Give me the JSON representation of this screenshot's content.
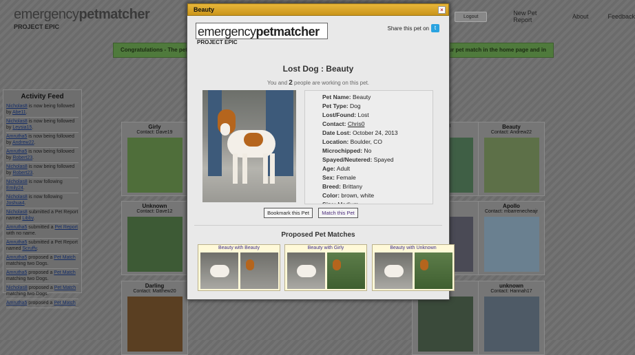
{
  "site": {
    "logo_light": "emergency",
    "logo_bold": "petmatcher",
    "subtitle": "PROJECT EPIC"
  },
  "nav": {
    "logout": "Logout",
    "links": [
      "New Pet Report",
      "About",
      "Feedback"
    ]
  },
  "banner": {
    "left": "Congratulations - The pet",
    "right": "our pet match in the home page and in"
  },
  "activity": {
    "title": "Activity Feed",
    "items": [
      {
        "user": "Nicholas8",
        "text": " is now being followed by ",
        "target": "Abe11",
        "tail": "."
      },
      {
        "user": "Nicholas8",
        "text": " is now being followed by ",
        "target": "Leysia15",
        "tail": "."
      },
      {
        "user": "Amrutha5",
        "text": " is now being followed by ",
        "target": "Andrew22",
        "tail": "."
      },
      {
        "user": "Amrutha5",
        "text": " is now being followed by ",
        "target": "Robert23",
        "tail": "."
      },
      {
        "user": "Nicholas8",
        "text": " is now being followed by ",
        "target": "Robert23",
        "tail": "."
      },
      {
        "user": "Nicholas8",
        "text": " is now following ",
        "target": "Emily24",
        "tail": "."
      },
      {
        "user": "Nicholas8",
        "text": " is now following ",
        "target": "Joshua4",
        "tail": "."
      },
      {
        "user": "Nicholas8",
        "text": " submitted a Pet Report named ",
        "target": "Libby",
        "tail": "."
      },
      {
        "user": "Amrutha5",
        "text": " submitted a ",
        "target": "Pet Report",
        "tail": " with no name."
      },
      {
        "user": "Amrutha5",
        "text": " submitted a Pet Report named ",
        "target": "Scruffy",
        "tail": "."
      },
      {
        "user": "Amrutha5",
        "text": " proposed a ",
        "target": "Pet Match",
        "tail": " matching two Dogs."
      },
      {
        "user": "Amrutha5",
        "text": " proposed a ",
        "target": "Pet Match",
        "tail": " matching two Dogs."
      },
      {
        "user": "Nicholas8",
        "text": " proposed a ",
        "target": "Pet Match",
        "tail": " matching two Dogs."
      },
      {
        "user": "Amrutha5",
        "text": " proposed a ",
        "target": "Pet Match",
        "tail": ""
      }
    ]
  },
  "cards": [
    {
      "name": "Girly",
      "contact": "Contact: Dave19"
    },
    {
      "name": "",
      "contact": "ert23"
    },
    {
      "name": "Beauty",
      "contact": "Contact: Andrew22"
    },
    {
      "name": "Unknown",
      "contact": "Contact: Dave12"
    },
    {
      "name": "",
      "contact": "ela6"
    },
    {
      "name": "Apollo",
      "contact": "Contact: mbarrenecheajr"
    },
    {
      "name": "Darling",
      "contact": "Contact: Matthew20"
    },
    {
      "name": "",
      "contact": "ve12"
    },
    {
      "name": "unknown",
      "contact": "Contact: Hannah17"
    }
  ],
  "modal": {
    "title": "Beauty",
    "close": "×",
    "share": "Share this pet on",
    "heading": "Lost Dog : Beauty",
    "working_pre": "You and ",
    "working_count": "2",
    "working_post": " people are working on this pet.",
    "details": [
      {
        "label": "Pet Name:",
        "value": "Beauty"
      },
      {
        "label": "Pet Type:",
        "value": "Dog"
      },
      {
        "label": "Lost/Found:",
        "value": "Lost"
      },
      {
        "label": "Contact:",
        "value": "Chris0",
        "link": true
      },
      {
        "label": "Date Lost:",
        "value": "October 24, 2013"
      },
      {
        "label": "Location:",
        "value": "Boulder, CO"
      },
      {
        "label": "Microchipped:",
        "value": "No"
      },
      {
        "label": "Spayed/Neutered:",
        "value": "Spayed"
      },
      {
        "label": "Age:",
        "value": "Adult"
      },
      {
        "label": "Sex:",
        "value": "Female"
      },
      {
        "label": "Breed:",
        "value": "Brittany"
      },
      {
        "label": "Color:",
        "value": "brown, white"
      },
      {
        "label": "Size:",
        "value": "Medium"
      }
    ],
    "bookmark": "Bookmark this Pet",
    "match": "Match this Pet",
    "proposed_title": "Proposed Pet Matches",
    "proposed": [
      "Beauty with Beauty",
      "Beauty with Girly",
      "Beauty with Unknown"
    ]
  },
  "colors": {
    "modal_title_bar": "#e8b63a",
    "banner": "#4f7a3c",
    "link": "#132c66",
    "twitter": "#2aa3e0"
  }
}
